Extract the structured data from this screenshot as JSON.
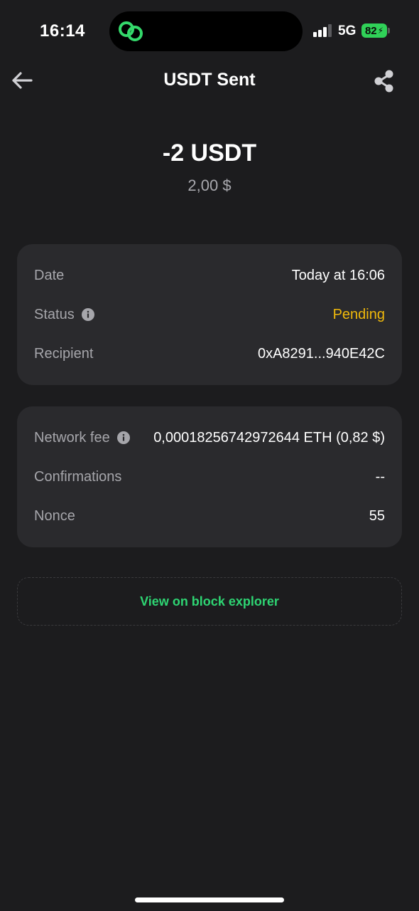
{
  "status_bar": {
    "time": "16:14",
    "network": "5G",
    "battery": "82"
  },
  "header": {
    "title": "USDT Sent",
    "back_icon": "arrow-left-icon",
    "share_icon": "share-icon"
  },
  "amount": {
    "crypto": "-2 USDT",
    "fiat": "2,00 $"
  },
  "details": {
    "date_label": "Date",
    "date_value": "Today at 16:06",
    "status_label": "Status",
    "status_value": "Pending",
    "status_color": "#f0b90b",
    "recipient_label": "Recipient",
    "recipient_value": "0xA8291...940E42C"
  },
  "fees": {
    "network_fee_label": "Network fee",
    "network_fee_value": "0,00018256742972644 ETH (0,82 $)",
    "confirmations_label": "Confirmations",
    "confirmations_value": "--",
    "nonce_label": "Nonce",
    "nonce_value": "55"
  },
  "explorer_button": {
    "label": "View on block explorer",
    "color": "#2ed573"
  },
  "colors": {
    "background": "#1c1c1e",
    "card": "#2a2a2d",
    "accent_green": "#2ed573",
    "pending": "#f0b90b"
  }
}
